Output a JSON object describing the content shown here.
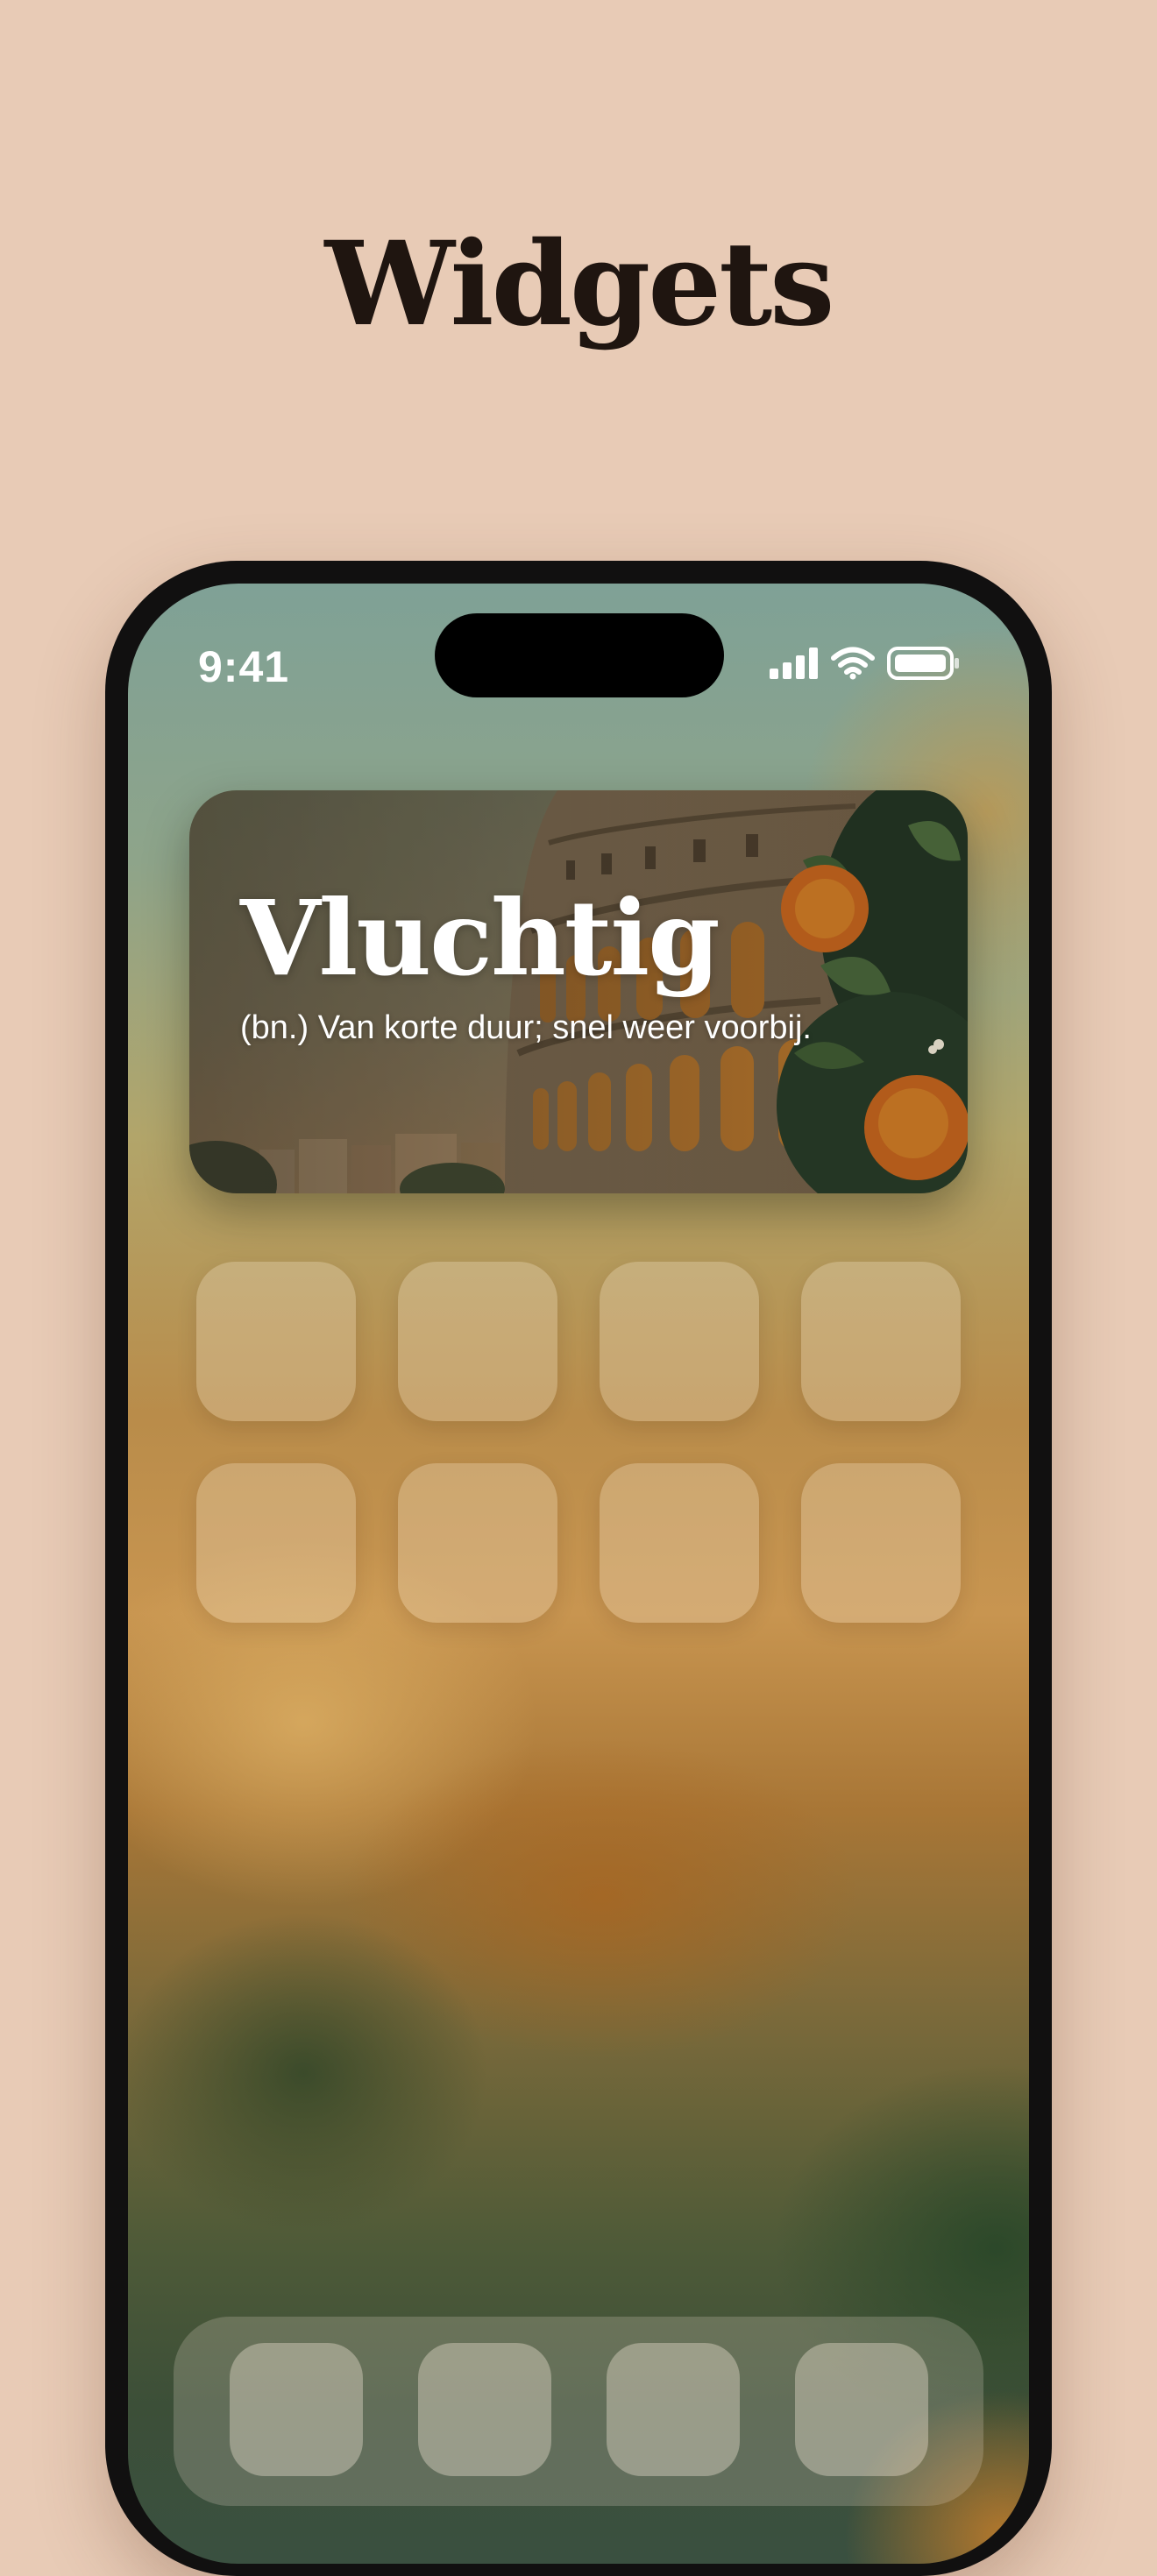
{
  "page": {
    "title": "Widgets"
  },
  "status_bar": {
    "time": "9:41",
    "icons": [
      "cellular-signal-icon",
      "wifi-icon",
      "battery-icon"
    ]
  },
  "widget": {
    "word": "Vluchtig",
    "definition": "(bn.) Van korte duur; snel weer voorbij.",
    "illustration": "colosseum-with-orange-tree"
  },
  "home_screen": {
    "app_rows": 2,
    "apps_per_row": 4,
    "dock_slots": 4
  },
  "colors": {
    "background": "#e8cbb6",
    "title_text": "#1f1510",
    "phone_frame": "#111010"
  }
}
